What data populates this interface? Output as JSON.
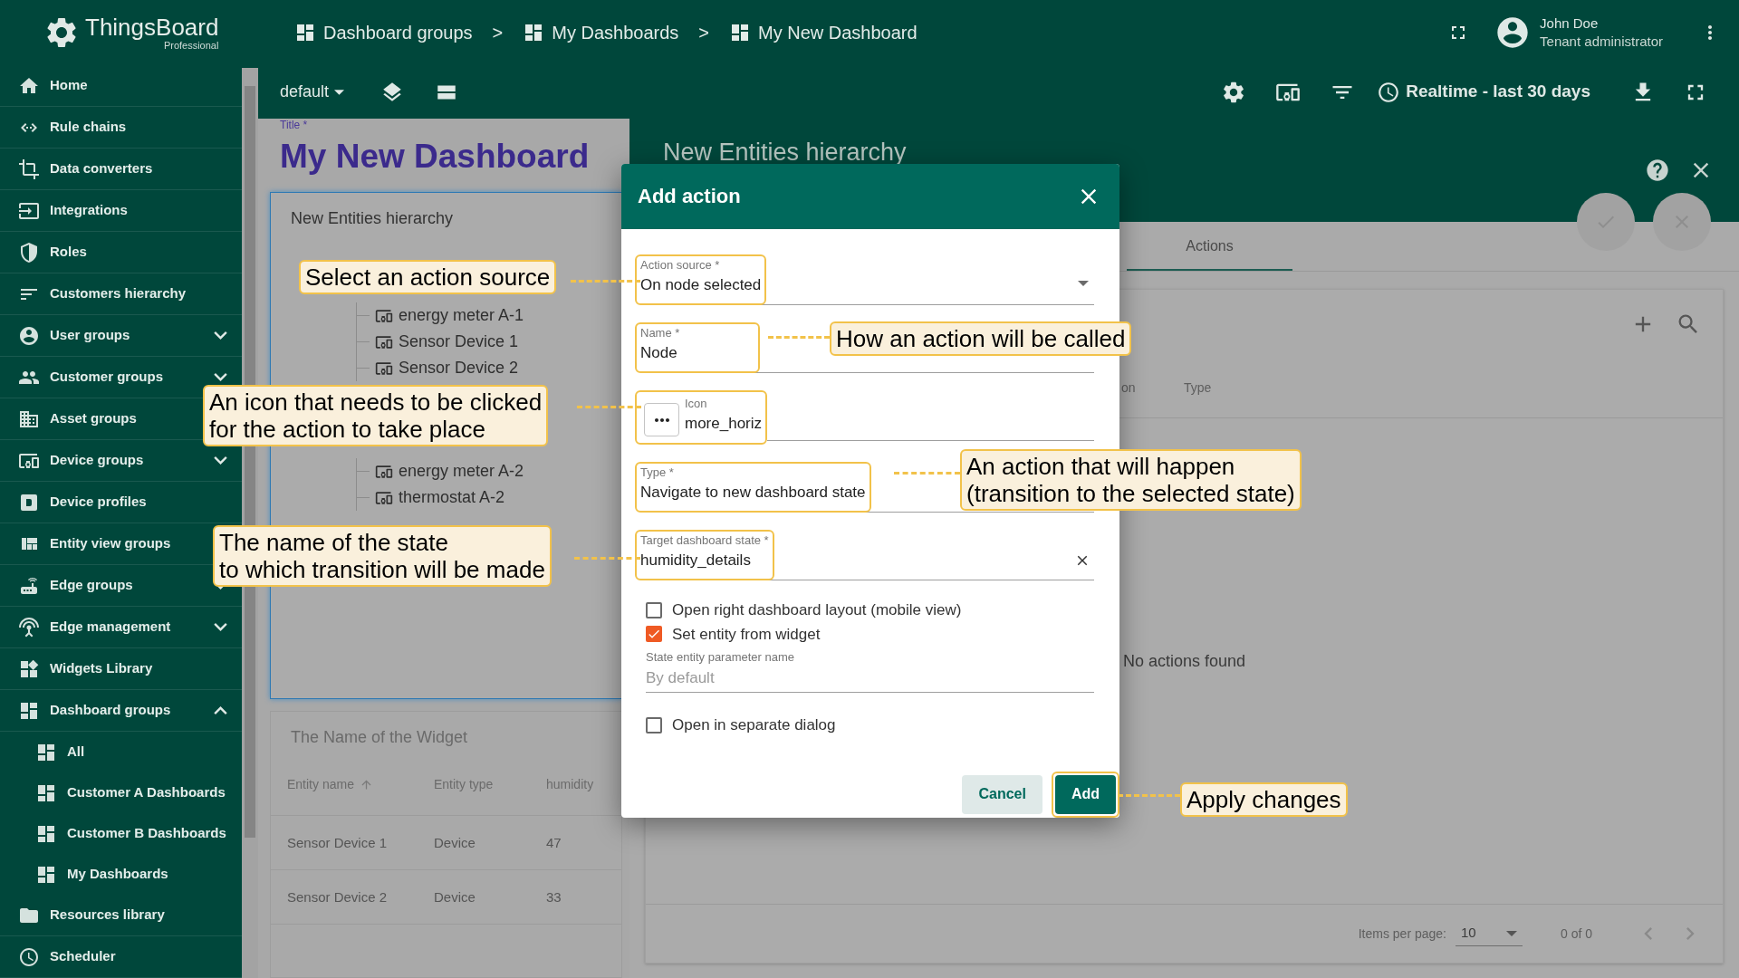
{
  "logo": {
    "name": "ThingsBoard",
    "edition": "Professional"
  },
  "sidebar": {
    "items": [
      {
        "label": "Home"
      },
      {
        "label": "Rule chains"
      },
      {
        "label": "Data converters"
      },
      {
        "label": "Integrations"
      },
      {
        "label": "Roles"
      },
      {
        "label": "Customers hierarchy"
      },
      {
        "label": "User groups",
        "expanded": false
      },
      {
        "label": "Customer groups",
        "expanded": false
      },
      {
        "label": "Asset groups"
      },
      {
        "label": "Device groups",
        "expanded": false
      },
      {
        "label": "Device profiles"
      },
      {
        "label": "Entity view groups"
      },
      {
        "label": "Edge groups",
        "expanded": false
      },
      {
        "label": "Edge management",
        "expanded": false
      },
      {
        "label": "Widgets Library"
      },
      {
        "label": "Dashboard groups",
        "expanded": true,
        "children": [
          {
            "label": "All"
          },
          {
            "label": "Customer A Dashboards"
          },
          {
            "label": "Customer B Dashboards"
          },
          {
            "label": "My Dashboards"
          }
        ]
      },
      {
        "label": "Resources library"
      },
      {
        "label": "Scheduler"
      }
    ]
  },
  "breadcrumbs": [
    {
      "kind": "crumb",
      "label": "Dashboard groups"
    },
    {
      "kind": "separator",
      "label": ">"
    },
    {
      "kind": "crumb",
      "label": "My Dashboards"
    },
    {
      "kind": "separator",
      "label": ">"
    },
    {
      "kind": "crumb",
      "label": "My New Dashboard"
    }
  ],
  "user": {
    "name": "John Doe",
    "role": "Tenant administrator"
  },
  "toolbar": {
    "state": "default",
    "timewindow": "Realtime - last 30 days"
  },
  "dashboard": {
    "title_label": "Title *",
    "title": "My New Dashboard",
    "tree_widget": {
      "title": "New Entities hierarchy",
      "branches": [
        {
          "children": [
            "energy meter A-1",
            "Sensor Device 1",
            "Sensor Device 2"
          ]
        },
        {
          "children": [
            "energy meter A-2",
            "thermostat A-2"
          ]
        }
      ]
    },
    "table_widget": {
      "title": "The Name of the Widget",
      "columns": [
        {
          "label": "Entity name",
          "sorted": true
        },
        {
          "label": "Entity type"
        },
        {
          "label": "humidity"
        }
      ],
      "rows": [
        [
          "Sensor Device 1",
          "Device",
          "47"
        ],
        [
          "Sensor Device 2",
          "Device",
          "33"
        ]
      ]
    }
  },
  "panel": {
    "title": "New Entities hierarchy",
    "tabs": [
      {
        "label": "Actions",
        "selected": true
      }
    ],
    "columns": [
      "on",
      "Type"
    ],
    "empty_text": "No actions found",
    "paginator": {
      "label": "Items per page:",
      "page_size": "10",
      "range": "0 of 0"
    }
  },
  "dialog": {
    "title": "Add action",
    "fields": [
      {
        "kind": "select",
        "label": "Action source *",
        "value": "On node selected",
        "highlighted": true
      },
      {
        "kind": "text",
        "label": "Name *",
        "value": "Node",
        "highlighted": true
      },
      {
        "kind": "icon",
        "label": "Icon",
        "value": "more_horiz",
        "highlighted": true
      },
      {
        "kind": "text",
        "label": "Type *",
        "value": "Navigate to new dashboard state",
        "highlighted": true
      },
      {
        "kind": "clearable",
        "label": "Target dashboard state *",
        "value": "humidity_details",
        "highlighted": true
      }
    ],
    "options": [
      {
        "kind": "checkbox",
        "label": "Open right dashboard layout (mobile view)",
        "checked": false
      },
      {
        "kind": "checkbox",
        "label": "Set entity from widget",
        "checked": true
      },
      {
        "kind": "input",
        "label": "State entity parameter name",
        "placeholder": "By default"
      },
      {
        "kind": "checkbox",
        "label": "Open in separate dialog",
        "checked": false
      }
    ],
    "buttons": [
      {
        "kind": "secondary",
        "label": "Cancel"
      },
      {
        "kind": "primary",
        "label": "Add",
        "highlighted": true
      }
    ]
  },
  "callouts": [
    {
      "lines": [
        "Select an action source"
      ]
    },
    {
      "lines": [
        "How an action will be called"
      ]
    },
    {
      "lines": [
        "An icon that needs to be clicked",
        "for the action to take place"
      ]
    },
    {
      "lines": [
        "An action that will happen",
        "(transition to the selected state)"
      ]
    },
    {
      "lines": [
        "The name of the state",
        "to which transition will be made"
      ]
    },
    {
      "lines": [
        "Apply changes"
      ]
    }
  ]
}
